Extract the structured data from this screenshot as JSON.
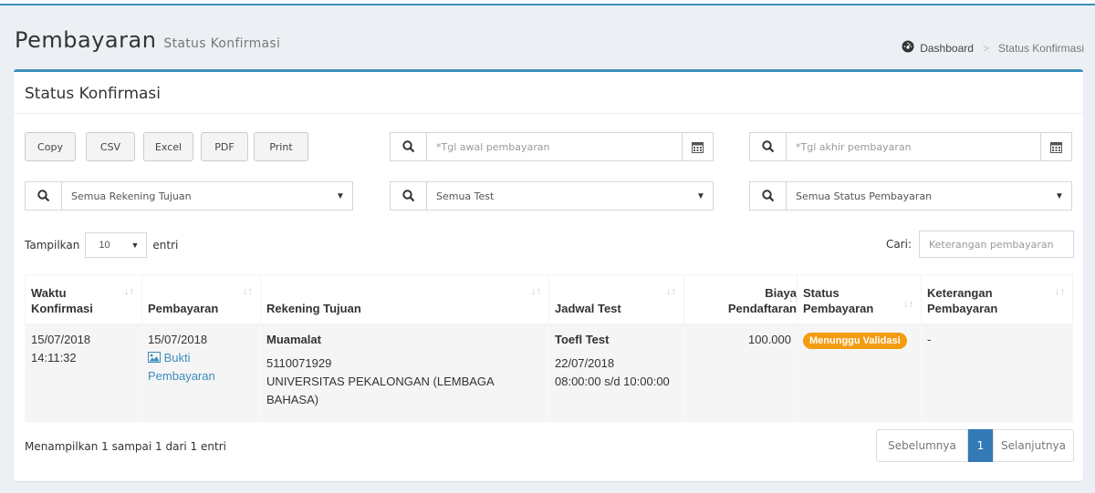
{
  "header": {
    "title": "Pembayaran",
    "subtitle": "Status Konfirmasi",
    "breadcrumb": {
      "home": "Dashboard",
      "current": "Status Konfirmasi"
    }
  },
  "box": {
    "title": "Status Konfirmasi",
    "export_buttons": {
      "copy": "Copy",
      "csv": "CSV",
      "excel": "Excel",
      "pdf": "PDF",
      "print": "Print"
    },
    "filters": {
      "start_date_placeholder": "*Tgl awal pembayaran",
      "end_date_placeholder": "*Tgl akhir pembayaran",
      "account": "Semua Rekening Tujuan",
      "test": "Semua Test",
      "status": "Semua Status Pembayaran"
    },
    "length": {
      "label_before": "Tampilkan",
      "value": "10",
      "label_after": "entri"
    },
    "search": {
      "label": "Cari:",
      "placeholder": "Keterangan pembayaran"
    }
  },
  "table": {
    "columns": {
      "waktu": [
        "Waktu",
        "Konfirmasi"
      ],
      "pembayaran": "Pembayaran",
      "rekening": "Rekening Tujuan",
      "jadwal": "Jadwal Test",
      "biaya": [
        "Biaya",
        "Pendaftaran"
      ],
      "status": [
        "Status",
        "Pembayaran"
      ],
      "keterangan": [
        "Keterangan",
        "Pembayaran"
      ]
    },
    "rows": [
      {
        "waktu_date": "15/07/2018",
        "waktu_time": "14:11:32",
        "pembayaran_date": "15/07/2018",
        "bukti_line1": "Bukti",
        "bukti_line2": "Pembayaran",
        "bank": "Muamalat",
        "account_no": "5110071929",
        "account_name": "UNIVERSITAS PEKALONGAN (LEMBAGA BAHASA)",
        "test_name": "Toefl Test",
        "test_date": "22/07/2018",
        "test_time": "08:00:00 s/d 10:00:00",
        "biaya": "100.000",
        "status": "Menunggu Validasi",
        "keterangan": "-"
      }
    ]
  },
  "footer": {
    "info": "Menampilkan 1 sampai 1 dari 1 entri",
    "prev": "Sebelumnya",
    "page": "1",
    "next": "Selanjutnya"
  },
  "colors": {
    "primary": "#3c8dbc",
    "warning": "#f39c12",
    "pager_active": "#337ab7"
  },
  "icons": {
    "breadcrumb": "dashboard-icon",
    "search": "search-icon",
    "calendar": "calendar-icon",
    "image": "image-icon",
    "sort": "sort-icon"
  }
}
